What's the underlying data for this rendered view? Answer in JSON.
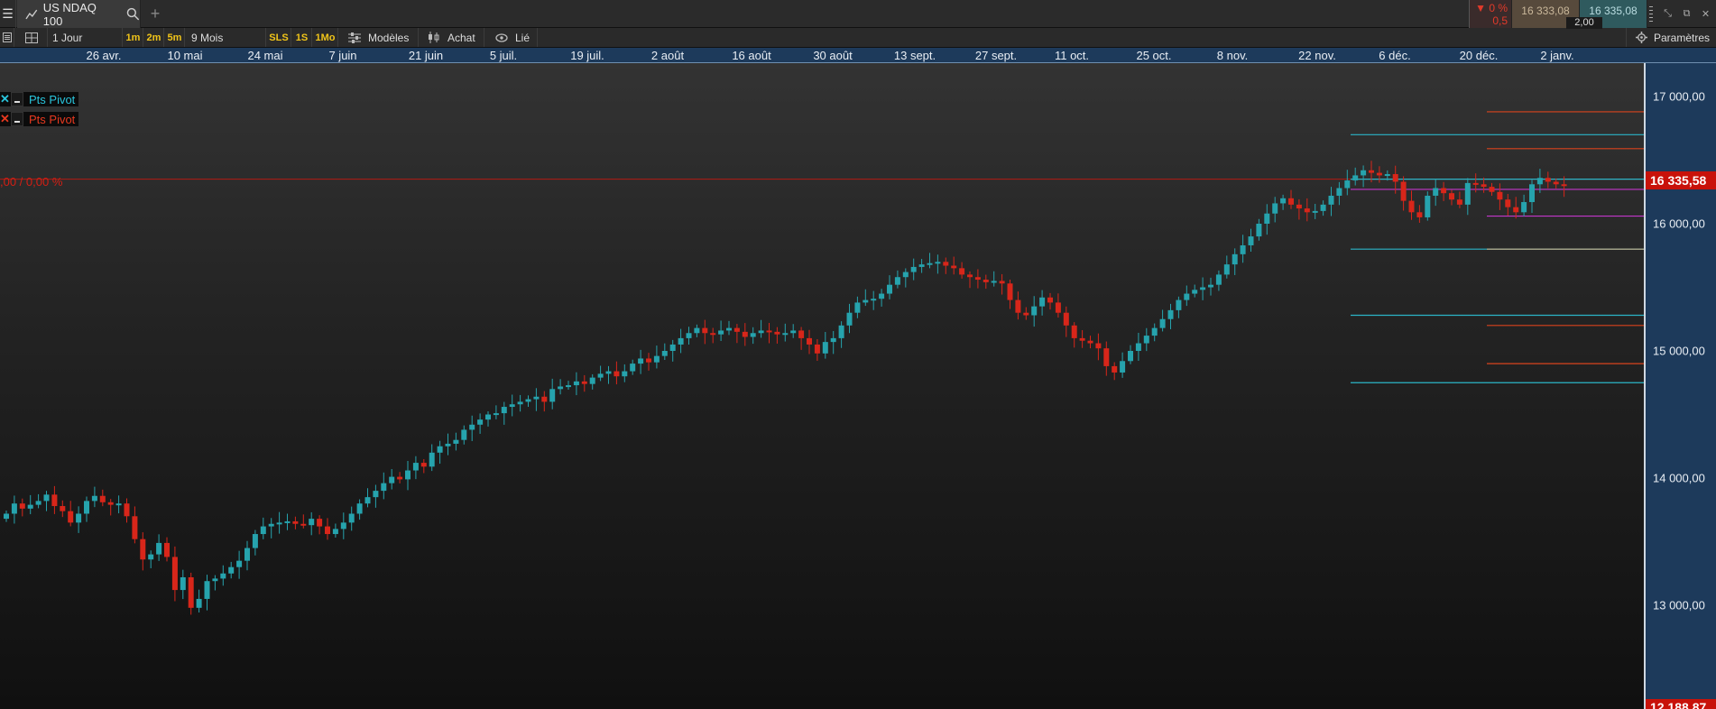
{
  "window": {
    "tab_title": "US NDAQ 100",
    "add_tab": "+"
  },
  "quote": {
    "change_pct": "▼ 0 %",
    "change_abs": "0,5",
    "bid": "16 333,08",
    "ask": "16 335,08",
    "spread": "2,00"
  },
  "toolbar": {
    "period": "1 Jour",
    "intervals": [
      "1m",
      "2m",
      "5m"
    ],
    "range": "9 Mois",
    "presets": [
      "SLS",
      "1S",
      "1Mo"
    ],
    "templates": "Modèles",
    "buy": "Achat",
    "linked": "Lié",
    "settings": "Paramètres"
  },
  "date_axis": [
    "26 avr.",
    "10 mai",
    "24 mai",
    "7 juin",
    "21 juin",
    "5 juil.",
    "19 juil.",
    "2 août",
    "16 août",
    "30 août",
    "13 sept.",
    "27 sept.",
    "11 oct.",
    "25 oct.",
    "8 nov.",
    "22 nov.",
    "6 déc.",
    "20 déc.",
    "2 janv."
  ],
  "price_axis": {
    "ticks": [
      "17 000,00",
      "16 000,00",
      "15 000,00",
      "14 000,00",
      "13 000,00"
    ],
    "current_price": "16 335,58",
    "low_price": "12 188,87"
  },
  "indicators": [
    {
      "name": "Pts Pivot",
      "color": "#29c5dc"
    },
    {
      "name": "Pts Pivot",
      "color": "#e8391f"
    }
  ],
  "reference_line_label": ",00 / 0,00 %",
  "colors": {
    "up": "#26a3ad",
    "down": "#d8261a",
    "axis_bg": "#1d3a5b",
    "current_price_bg": "#c8120a"
  },
  "chart_data": {
    "type": "candlestick",
    "instrument": "US NDAQ 100",
    "interval": "1 Jour",
    "ylim": [
      12188.87,
      17250
    ],
    "current_price": 16335.58,
    "closes": [
      13720,
      13800,
      13760,
      13790,
      13820,
      13870,
      13780,
      13740,
      13650,
      13720,
      13820,
      13860,
      13810,
      13790,
      13800,
      13700,
      13520,
      13360,
      13400,
      13490,
      13380,
      13120,
      13220,
      12980,
      13050,
      13190,
      13210,
      13250,
      13300,
      13350,
      13450,
      13560,
      13620,
      13640,
      13650,
      13660,
      13640,
      13630,
      13680,
      13620,
      13560,
      13600,
      13650,
      13720,
      13800,
      13850,
      13900,
      13960,
      14010,
      13990,
      14060,
      14120,
      14090,
      14200,
      14250,
      14270,
      14300,
      14380,
      14420,
      14460,
      14500,
      14510,
      14560,
      14580,
      14600,
      14620,
      14640,
      14600,
      14700,
      14720,
      14730,
      14760,
      14740,
      14790,
      14820,
      14840,
      14800,
      14840,
      14900,
      14940,
      14910,
      14960,
      15000,
      15050,
      15100,
      15140,
      15180,
      15140,
      15130,
      15160,
      15180,
      15150,
      15110,
      15140,
      15160,
      15150,
      15130,
      15140,
      15160,
      15100,
      15050,
      14980,
      15070,
      15100,
      15200,
      15300,
      15380,
      15400,
      15410,
      15450,
      15520,
      15580,
      15620,
      15660,
      15680,
      15690,
      15700,
      15670,
      15650,
      15600,
      15580,
      15560,
      15540,
      15550,
      15530,
      15400,
      15300,
      15280,
      15350,
      15420,
      15380,
      15300,
      15200,
      15100,
      15080,
      15060,
      15020,
      14880,
      14830,
      14920,
      15000,
      15060,
      15120,
      15180,
      15250,
      15320,
      15400,
      15450,
      15480,
      15500,
      15520,
      15600,
      15680,
      15760,
      15830,
      15900,
      16000,
      16080,
      16160,
      16200,
      16150,
      16120,
      16090,
      16100,
      16150,
      16220,
      16280,
      16340,
      16380,
      16420,
      16400,
      16380,
      16390,
      16330,
      16180,
      16090,
      16050,
      16220,
      16280,
      16240,
      16190,
      16150,
      16320,
      16310,
      16290,
      16250,
      16190,
      16130,
      16090,
      16170,
      16310,
      16360,
      16330,
      16310,
      16298
    ]
  }
}
